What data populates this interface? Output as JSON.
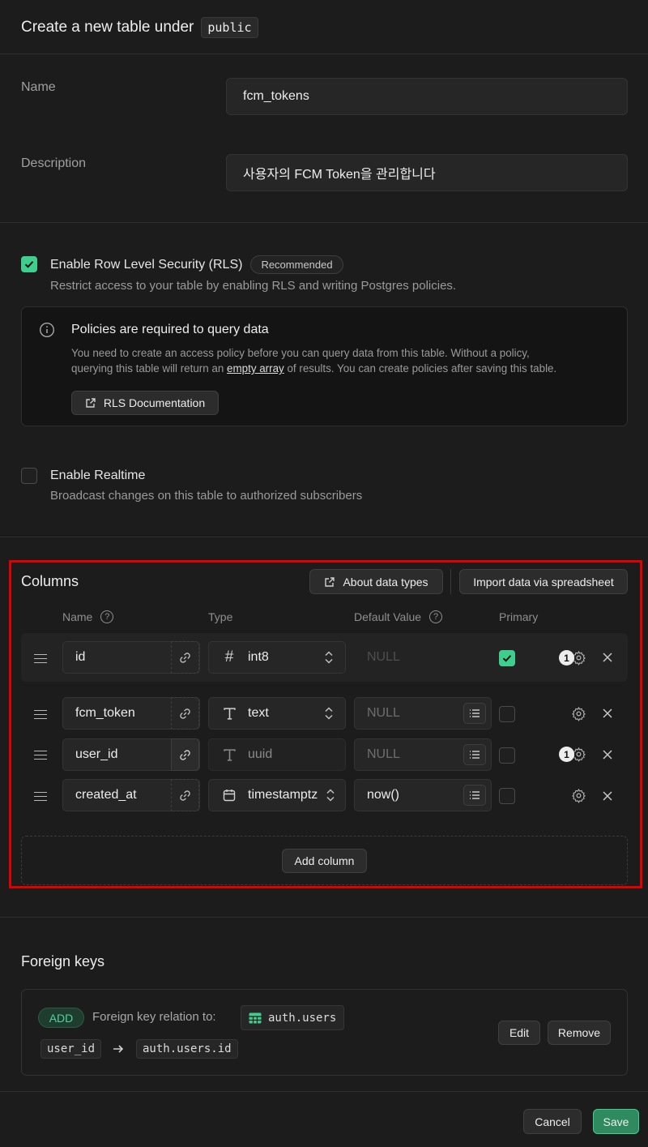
{
  "header": {
    "title": "Create a new table under",
    "schema": "public"
  },
  "form": {
    "name_label": "Name",
    "name_value": "fcm_tokens",
    "description_label": "Description",
    "description_value": "사용자의 FCM Token을 관리합니다"
  },
  "rls": {
    "checked": true,
    "label": "Enable Row Level Security (RLS)",
    "badge": "Recommended",
    "description": "Restrict access to your table by enabling RLS and writing Postgres policies.",
    "info_title": "Policies are required to query data",
    "info_text_1": "You need to create an access policy before you can query data from this table. Without a policy,",
    "info_text_2_before": "querying this table will return an",
    "info_link": "empty array",
    "info_text_2_after": "of results. You can create policies after saving this table.",
    "doc_button": "RLS Documentation"
  },
  "realtime": {
    "checked": false,
    "label": "Enable Realtime",
    "description": "Broadcast changes on this table to authorized subscribers"
  },
  "columns": {
    "title": "Columns",
    "about_button": "About data types",
    "import_button": "Import data via spreadsheet",
    "headers": {
      "name": "Name",
      "type": "Type",
      "default": "Default Value",
      "primary": "Primary"
    },
    "rows": [
      {
        "name": "id",
        "type": "int8",
        "type_icon": "hash-icon",
        "default": "NULL",
        "primary": true,
        "badge": "1"
      },
      {
        "name": "fcm_token",
        "type": "text",
        "type_icon": "text-type-icon",
        "default": "NULL",
        "primary": false
      },
      {
        "name": "user_id",
        "type": "uuid",
        "type_icon": "text-type-icon",
        "default": "NULL",
        "primary": false,
        "badge": "1"
      },
      {
        "name": "created_at",
        "type": "timestamptz",
        "type_icon": "calendar-icon",
        "default": "now()",
        "primary": false
      }
    ],
    "add_button": "Add column"
  },
  "foreign_keys": {
    "title": "Foreign keys",
    "add_badge": "ADD",
    "relation_label": "Foreign key relation to:",
    "target_table": "auth.users",
    "source_column": "user_id",
    "target_column": "auth.users.id",
    "edit_button": "Edit",
    "remove_button": "Remove"
  },
  "footer": {
    "cancel": "Cancel",
    "save": "Save"
  },
  "colors": {
    "accent": "#3ecf8e",
    "highlight": "#e00000"
  }
}
